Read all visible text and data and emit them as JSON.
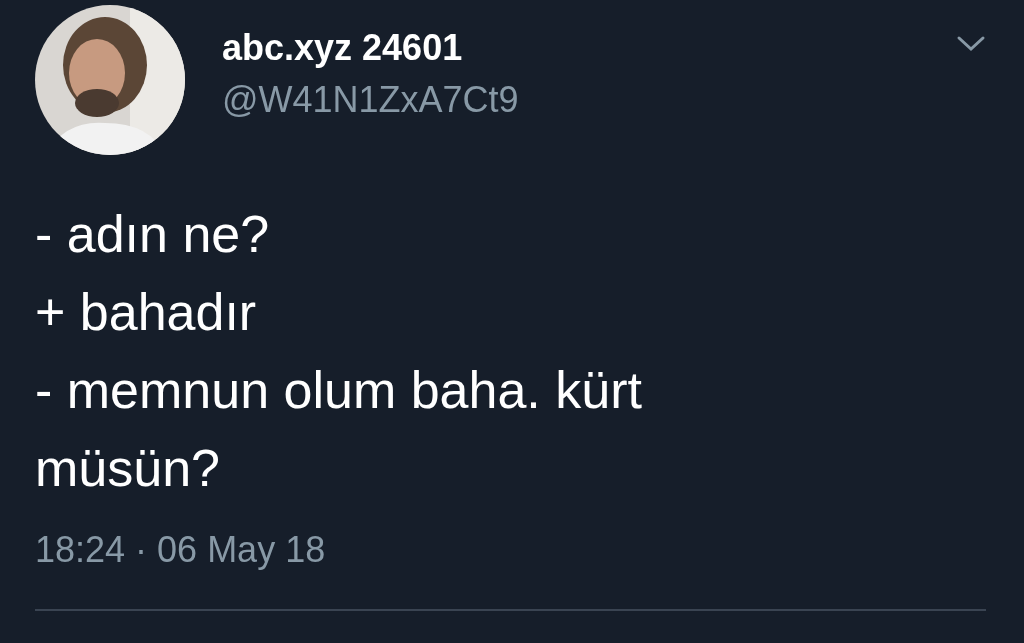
{
  "tweet": {
    "author": {
      "name": "abc.xyz 24601",
      "handle": "@W41N1ZxA7Ct9"
    },
    "lines": [
      "- adın ne?",
      "+ bahadır",
      "- memnun olum baha. kürt müsün?"
    ],
    "timestamp": "18:24 · 06 May 18"
  }
}
